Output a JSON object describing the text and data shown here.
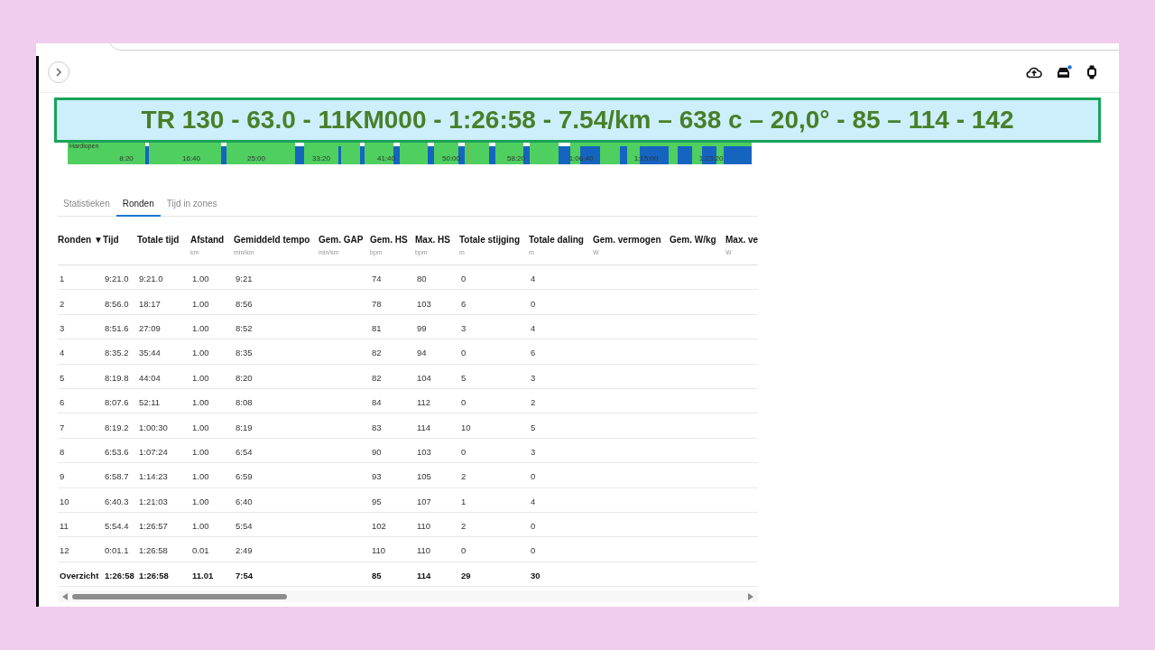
{
  "banner": {
    "text": "TR 130 - 63.0 - 11KM000 - 1:26:58 - 7.54/km – 638 c – 20,0° - 85 – 114 - 142"
  },
  "timeline": {
    "label": "Hardlopen",
    "ticks": [
      "8:20",
      "16:40",
      "25:00",
      "33:20",
      "41:40",
      "50:00",
      "58:20",
      "1:06:40",
      "1:15:00",
      "1:23:20"
    ]
  },
  "tabs": [
    {
      "label": "Statistieken",
      "selected": false
    },
    {
      "label": "Ronden",
      "selected": true
    },
    {
      "label": "Tijd in zones",
      "selected": false
    }
  ],
  "table": {
    "columns": [
      {
        "label": "Ronden ▼"
      },
      {
        "label": "Tijd"
      },
      {
        "label": "Totale tijd"
      },
      {
        "label": "Afstand",
        "unit": "km"
      },
      {
        "label": "Gemiddeld tempo",
        "unit": "min/km"
      },
      {
        "label": "Gem. GAP",
        "unit": "min/km"
      },
      {
        "label": "Gem. HS",
        "unit": "bpm"
      },
      {
        "label": "Max. HS",
        "unit": "bpm"
      },
      {
        "label": "Totale stijging",
        "unit": "m"
      },
      {
        "label": "Totale daling",
        "unit": "m"
      },
      {
        "label": "Gem. vermogen",
        "unit": "W"
      },
      {
        "label": "Gem. W/kg"
      },
      {
        "label": "Max. ve",
        "unit": "W"
      }
    ],
    "rows": [
      {
        "lap": "1",
        "time": "9:21.0",
        "total_time": "9:21.0",
        "distance": "1.00",
        "avg_pace": "9:21",
        "avg_hr": "74",
        "max_hr": "80",
        "ascent": "0",
        "descent": "4"
      },
      {
        "lap": "2",
        "time": "8:56.0",
        "total_time": "18:17",
        "distance": "1.00",
        "avg_pace": "8:56",
        "avg_hr": "78",
        "max_hr": "103",
        "ascent": "6",
        "descent": "0"
      },
      {
        "lap": "3",
        "time": "8:51.6",
        "total_time": "27:09",
        "distance": "1.00",
        "avg_pace": "8:52",
        "avg_hr": "81",
        "max_hr": "99",
        "ascent": "3",
        "descent": "4"
      },
      {
        "lap": "4",
        "time": "8:35.2",
        "total_time": "35:44",
        "distance": "1.00",
        "avg_pace": "8:35",
        "avg_hr": "82",
        "max_hr": "94",
        "ascent": "0",
        "descent": "6"
      },
      {
        "lap": "5",
        "time": "8:19.8",
        "total_time": "44:04",
        "distance": "1.00",
        "avg_pace": "8:20",
        "avg_hr": "82",
        "max_hr": "104",
        "ascent": "5",
        "descent": "3"
      },
      {
        "lap": "6",
        "time": "8:07.6",
        "total_time": "52:11",
        "distance": "1.00",
        "avg_pace": "8:08",
        "avg_hr": "84",
        "max_hr": "112",
        "ascent": "0",
        "descent": "2"
      },
      {
        "lap": "7",
        "time": "8:19.2",
        "total_time": "1:00:30",
        "distance": "1.00",
        "avg_pace": "8:19",
        "avg_hr": "83",
        "max_hr": "114",
        "ascent": "10",
        "descent": "5"
      },
      {
        "lap": "8",
        "time": "6:53.6",
        "total_time": "1:07:24",
        "distance": "1.00",
        "avg_pace": "6:54",
        "avg_hr": "90",
        "max_hr": "103",
        "ascent": "0",
        "descent": "3"
      },
      {
        "lap": "9",
        "time": "6:58.7",
        "total_time": "1:14:23",
        "distance": "1.00",
        "avg_pace": "6:59",
        "avg_hr": "93",
        "max_hr": "105",
        "ascent": "2",
        "descent": "0"
      },
      {
        "lap": "10",
        "time": "6:40.3",
        "total_time": "1:21:03",
        "distance": "1.00",
        "avg_pace": "6:40",
        "avg_hr": "95",
        "max_hr": "107",
        "ascent": "1",
        "descent": "4"
      },
      {
        "lap": "11",
        "time": "5:54.4",
        "total_time": "1:26:57",
        "distance": "1.00",
        "avg_pace": "5:54",
        "avg_hr": "102",
        "max_hr": "110",
        "ascent": "2",
        "descent": "0"
      },
      {
        "lap": "12",
        "time": "0:01.1",
        "total_time": "1:26:58",
        "distance": "0.01",
        "avg_pace": "2:49",
        "avg_hr": "110",
        "max_hr": "110",
        "ascent": "0",
        "descent": "0"
      }
    ],
    "summary": {
      "lap": "Overzicht",
      "time": "1:26:58",
      "total_time": "1:26:58",
      "distance": "11.01",
      "avg_pace": "7:54",
      "avg_hr": "85",
      "max_hr": "114",
      "ascent": "29",
      "descent": "30"
    }
  }
}
